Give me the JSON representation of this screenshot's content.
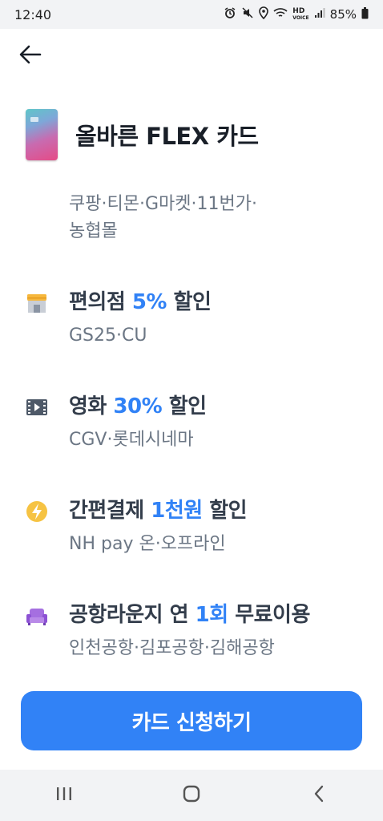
{
  "status_bar": {
    "time": "12:40",
    "battery": "85%",
    "icons": [
      "alarm-icon",
      "mute-icon",
      "location-icon",
      "wifi-icon",
      "hd-voice-icon",
      "signal-icon",
      "battery-icon"
    ]
  },
  "header": {
    "back_icon": "arrow-left-icon"
  },
  "card": {
    "name": "올바른 FLEX 카드",
    "online_shops": "쿠팡·티몬·G마켓·11번가·\n농협몰"
  },
  "benefits": [
    {
      "icon": "store-icon",
      "title_prefix": "편의점 ",
      "highlight": "5%",
      "title_suffix": " 할인",
      "subtitle": "GS25·CU"
    },
    {
      "icon": "film-icon",
      "title_prefix": "영화 ",
      "highlight": "30%",
      "title_suffix": " 할인",
      "subtitle": "CGV·롯데시네마"
    },
    {
      "icon": "lightning-icon",
      "title_prefix": "간편결제 ",
      "highlight": "1천원",
      "title_suffix": " 할인",
      "subtitle": "NH pay 온·오프라인"
    },
    {
      "icon": "sofa-icon",
      "title_prefix": "공항라운지 연 ",
      "highlight": "1회",
      "title_suffix": " 무료이용",
      "subtitle": "인천공항·김포공항·김해공항"
    }
  ],
  "apply_button": {
    "label": "카드 신청하기"
  },
  "colors": {
    "accent": "#3182f6",
    "title": "#191f28",
    "subtext": "#6b7684"
  },
  "nav_bar": {
    "icons": [
      "recent-apps-icon",
      "home-icon",
      "back-icon"
    ]
  }
}
